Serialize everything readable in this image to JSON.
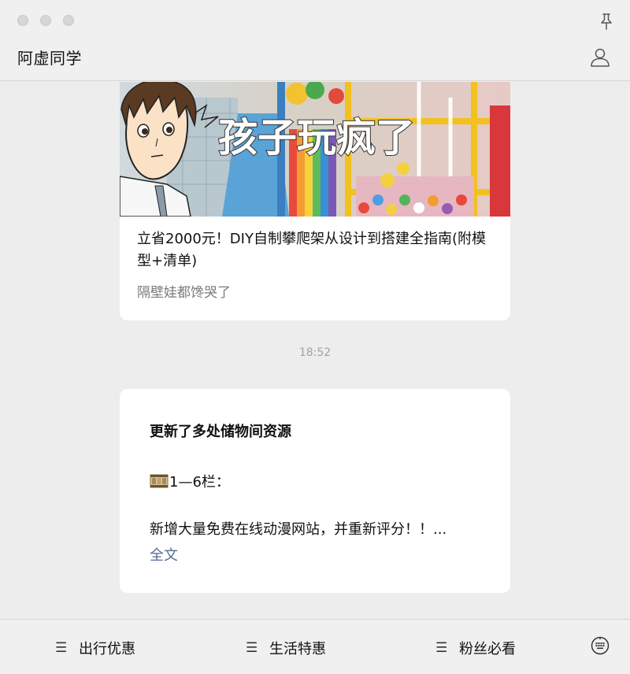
{
  "header": {
    "title": "阿虚同学"
  },
  "article": {
    "cover_text": "孩子玩疯了",
    "title": "立省2000元！DIY自制攀爬架从设计到搭建全指南(附模型+清单)",
    "digest": "隔壁娃都馋哭了"
  },
  "timestamp": "18:52",
  "message": {
    "heading": "更新了多处储物间资源",
    "line1": "1—6栏：",
    "line2": "新增大量免费在线动漫网站，并重新评分！！...",
    "more": "全文"
  },
  "menu": {
    "items": [
      {
        "icon": "☰",
        "label": "出行优惠"
      },
      {
        "icon": "☰",
        "label": "生活特惠"
      },
      {
        "icon": "☰",
        "label": "粉丝必看"
      }
    ]
  },
  "colors": {
    "link": "#576b95",
    "background": "#ededed"
  }
}
